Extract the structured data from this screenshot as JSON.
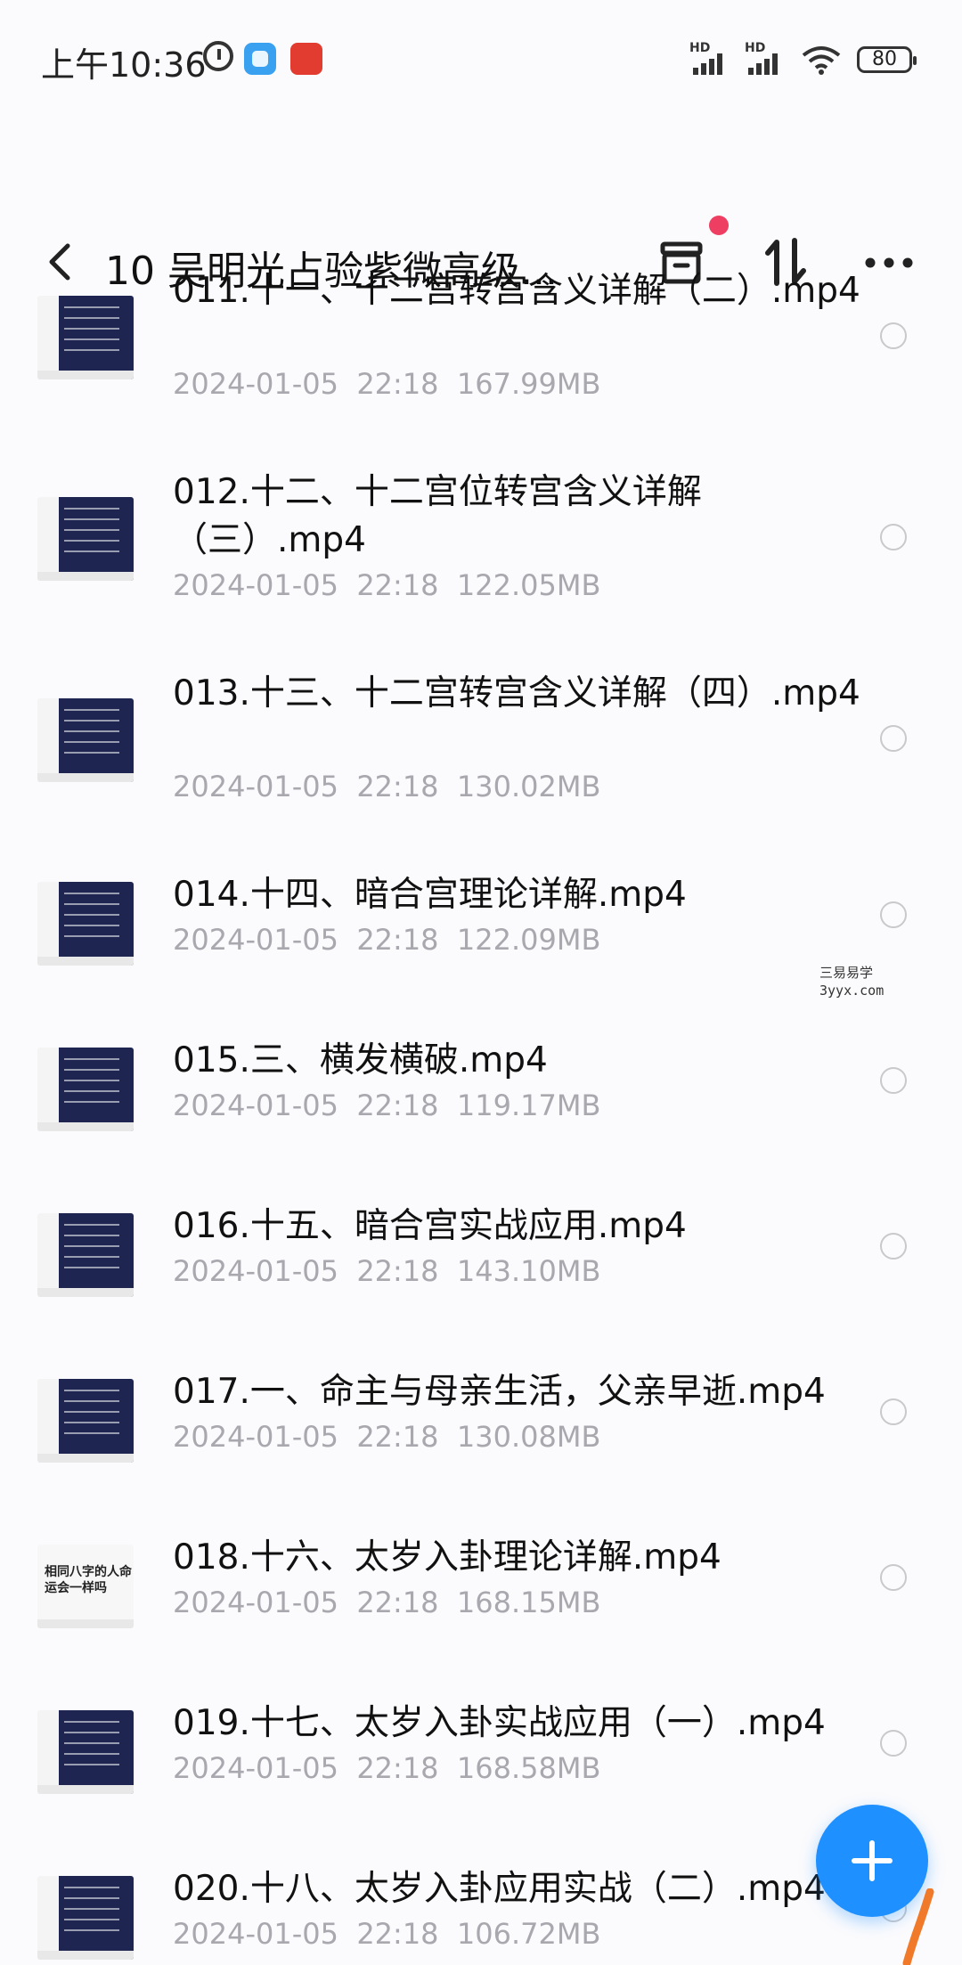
{
  "status_bar": {
    "time": "上午10:36",
    "signal_1": "HD",
    "signal_2": "HD",
    "battery": "80",
    "icons": [
      "alarm-icon",
      "app-icon",
      "news-app-icon",
      "wifi-icon"
    ]
  },
  "header": {
    "title": "10 吴明光占验紫微高级...",
    "icons": [
      "back-icon",
      "archive-icon",
      "sort-icon",
      "more-icon"
    ],
    "notification_dot_color": "#ee3e62"
  },
  "files": [
    {
      "name": "011.十一、十二宫转宫含义详解（二）.mp4",
      "date": "2024-01-05",
      "time": "22:18",
      "size": "167.99MB"
    },
    {
      "name": "012.十二、十二宫位转宫含义详解（三）.mp4",
      "date": "2024-01-05",
      "time": "22:18",
      "size": "122.05MB"
    },
    {
      "name": "013.十三、十二宫转宫含义详解（四）.mp4",
      "date": "2024-01-05",
      "time": "22:18",
      "size": "130.02MB"
    },
    {
      "name": "014.十四、暗合宫理论详解.mp4",
      "date": "2024-01-05",
      "time": "22:18",
      "size": "122.09MB"
    },
    {
      "name": "015.三、横发横破.mp4",
      "date": "2024-01-05",
      "time": "22:18",
      "size": "119.17MB"
    },
    {
      "name": "016.十五、暗合宫实战应用.mp4",
      "date": "2024-01-05",
      "time": "22:18",
      "size": "143.10MB"
    },
    {
      "name": "017.一、命主与母亲生活，父亲早逝.mp4",
      "date": "2024-01-05",
      "time": "22:18",
      "size": "130.08MB"
    },
    {
      "name": "018.十六、太岁入卦理论详解.mp4",
      "date": "2024-01-05",
      "time": "22:18",
      "size": "168.15MB"
    },
    {
      "name": "019.十七、太岁入卦实战应用（一）.mp4",
      "date": "2024-01-05",
      "time": "22:18",
      "size": "168.58MB"
    },
    {
      "name": "020.十八、太岁入卦应用实战（二）.mp4",
      "date": "2024-01-05",
      "time": "22:18",
      "size": "106.72MB"
    }
  ],
  "thumb_text_018": "相同八字的人命运会一样吗",
  "watermark": {
    "line1": "三易易学",
    "line2": "3yyx.com"
  },
  "fab": {
    "icon": "plus-icon",
    "color": "#1e90ff"
  }
}
